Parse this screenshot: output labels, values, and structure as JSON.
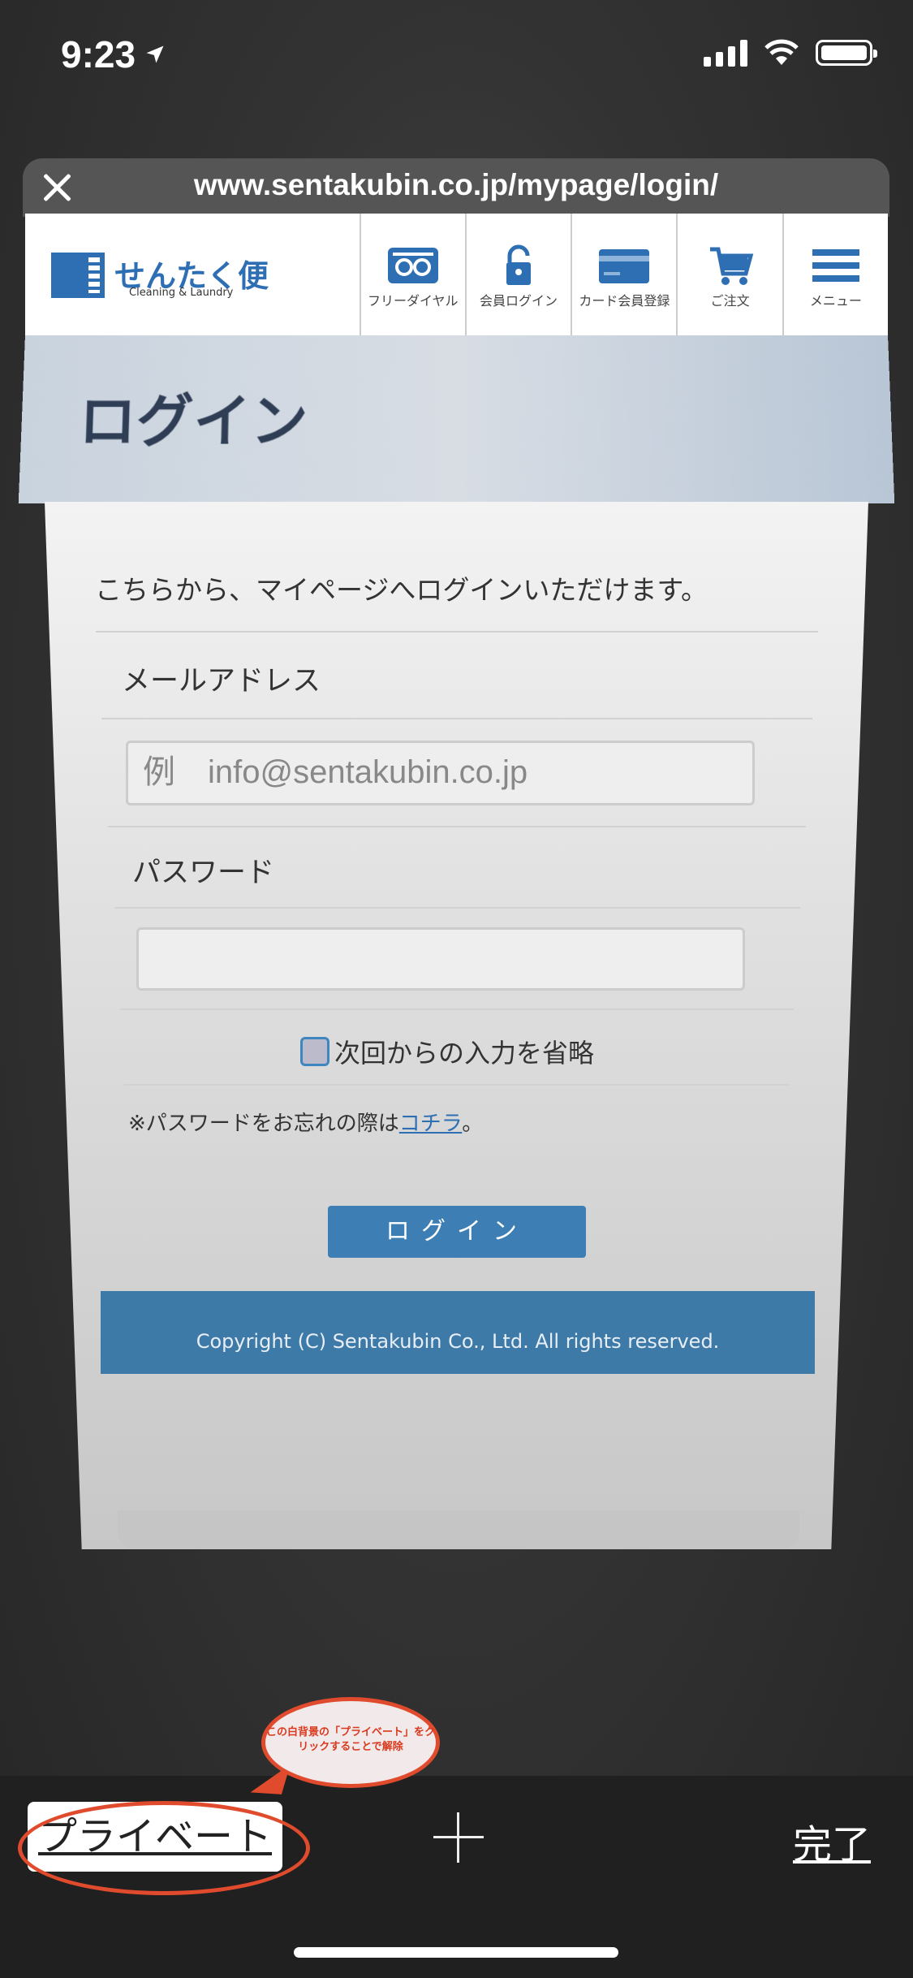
{
  "status_bar": {
    "time": "9:23",
    "location_icon": "location-arrow-icon",
    "signal_icon": "cellular-signal-icon",
    "wifi_icon": "wifi-icon",
    "battery_icon": "battery-icon"
  },
  "tab": {
    "url": "www.sentakubin.co.jp/mypage/login/"
  },
  "site": {
    "logo_text": "せんたく便",
    "logo_sub": "Cleaning & Laundry",
    "nav": [
      {
        "label": "フリーダイヤル",
        "icon": "free-dial-icon"
      },
      {
        "label": "会員ログイン",
        "icon": "lock-icon"
      },
      {
        "label": "カード会員登録",
        "icon": "credit-card-icon"
      },
      {
        "label": "ご注文",
        "icon": "cart-icon"
      },
      {
        "label": "メニュー",
        "icon": "hamburger-menu-icon"
      }
    ],
    "hero_title": "ログイン",
    "intro": "こちらから、マイページへログインいただけます。",
    "email_label": "メールアドレス",
    "email_placeholder": "例　info@sentakubin.co.jp",
    "password_label": "パスワード",
    "password_value": "",
    "remember_label": "次回からの入力を省略",
    "forgot_prefix": "※パスワードをお忘れの際は",
    "forgot_link": "コチラ",
    "forgot_suffix": "。",
    "login_button": "ログイン",
    "copyright": "Copyright (C) Sentakubin Co., Ltd. All rights reserved."
  },
  "toolbar": {
    "private_label": "プライベート",
    "annotation": "この白背景の「プライベート」をクリックすることで解除",
    "new_tab_icon": "plus-icon",
    "done_label": "完了"
  },
  "colors": {
    "accent": "#2e6fb3",
    "button": "#3d7fb4",
    "annotation": "#e04b2d"
  }
}
